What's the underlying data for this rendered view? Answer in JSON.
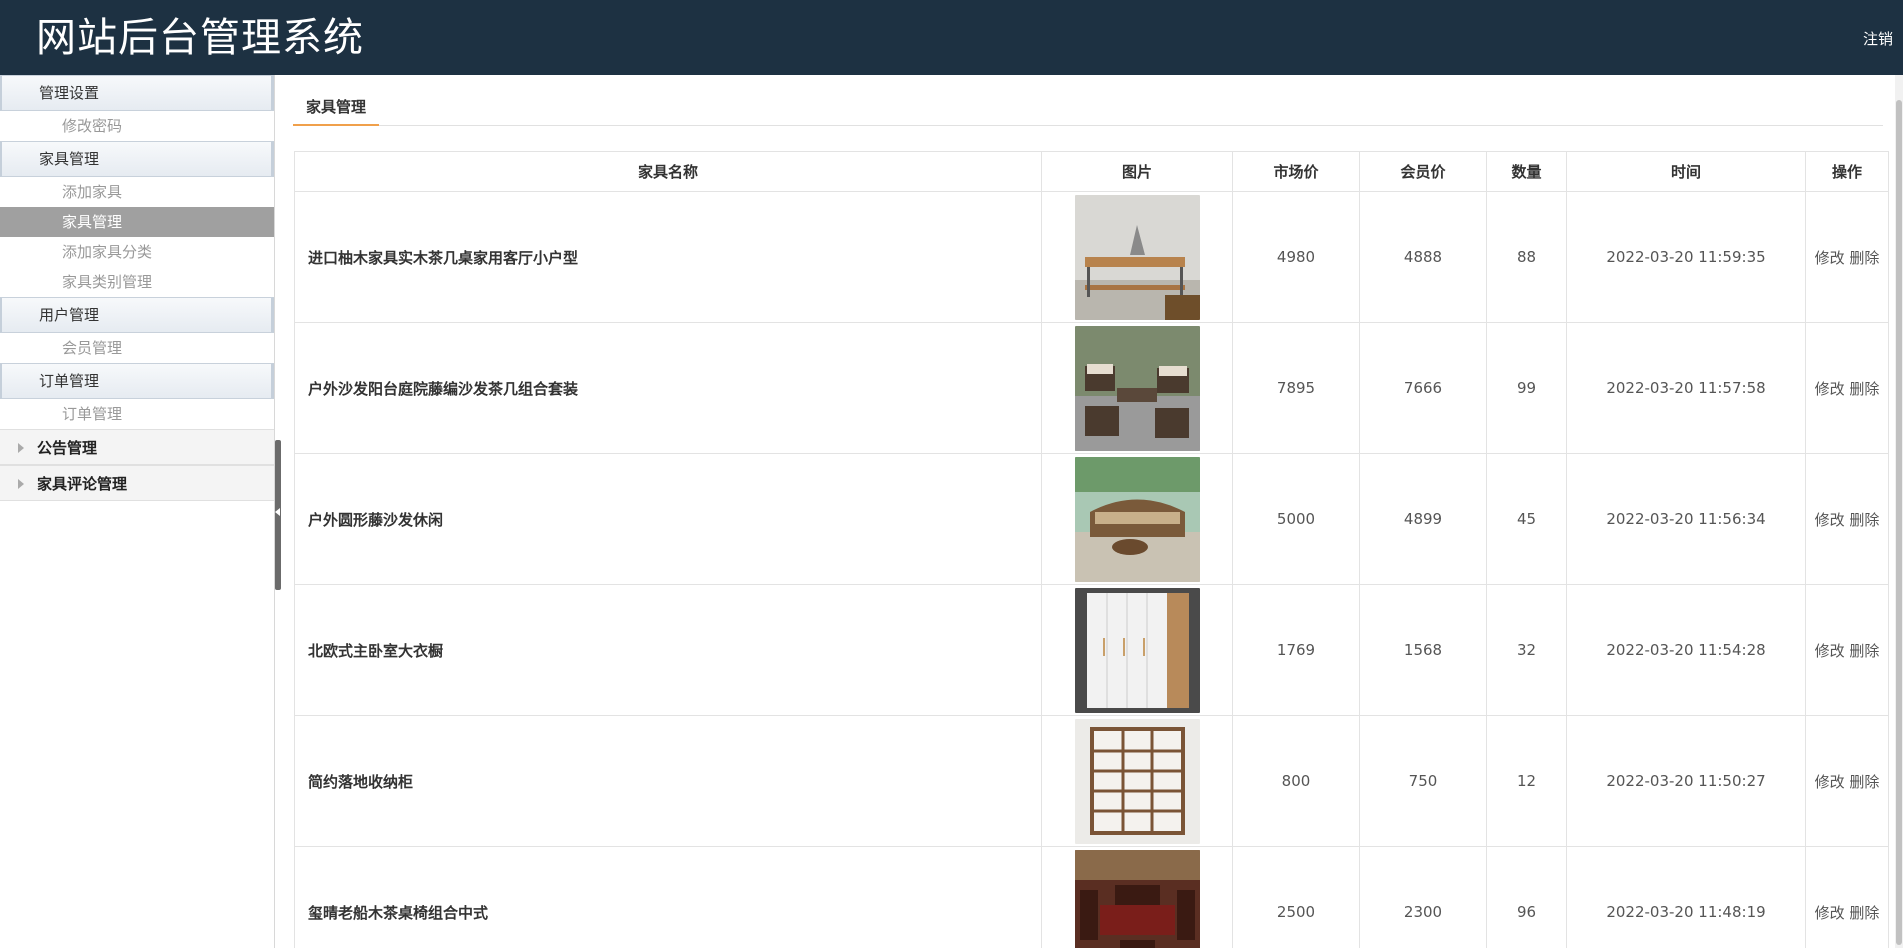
{
  "header": {
    "title": "网站后台管理系统",
    "logout": "注销"
  },
  "sidebar": {
    "groups": [
      {
        "title": "管理设置",
        "items": [
          {
            "label": "修改密码"
          }
        ]
      },
      {
        "title": "家具管理",
        "items": [
          {
            "label": "添加家具"
          },
          {
            "label": "家具管理"
          },
          {
            "label": "添加家具分类"
          },
          {
            "label": "家具类别管理"
          }
        ]
      },
      {
        "title": "用户管理",
        "items": [
          {
            "label": "会员管理"
          }
        ]
      },
      {
        "title": "订单管理",
        "items": [
          {
            "label": "订单管理"
          }
        ]
      }
    ],
    "collapsed": [
      {
        "title": "公告管理"
      },
      {
        "title": "家具评论管理"
      }
    ]
  },
  "main": {
    "tab": "家具管理",
    "columns": [
      "家具名称",
      "图片",
      "市场价",
      "会员价",
      "数量",
      "时间",
      "操作"
    ],
    "rows": [
      {
        "name": "进口柚木家具实木茶几桌家用客厅小户型",
        "image": "teak-coffee-table",
        "market": "4980",
        "member": "4888",
        "qty": "88",
        "time": "2022-03-20 11:59:35"
      },
      {
        "name": "户外沙发阳台庭院藤编沙发茶几组合套装",
        "image": "rattan-sofa-set",
        "market": "7895",
        "member": "7666",
        "qty": "99",
        "time": "2022-03-20 11:57:58"
      },
      {
        "name": "户外圆形藤沙发休闲",
        "image": "round-rattan-sofa",
        "market": "5000",
        "member": "4899",
        "qty": "45",
        "time": "2022-03-20 11:56:34"
      },
      {
        "name": "北欧式主卧室大衣橱",
        "image": "wardrobe",
        "market": "1769",
        "member": "1568",
        "qty": "32",
        "time": "2022-03-20 11:54:28"
      },
      {
        "name": "简约落地收纳柜",
        "image": "storage-shelf",
        "market": "800",
        "member": "750",
        "qty": "12",
        "time": "2022-03-20 11:50:27"
      },
      {
        "name": "玺晴老船木茶桌椅组合中式",
        "image": "tea-table-set",
        "market": "2500",
        "member": "2300",
        "qty": "96",
        "time": "2022-03-20 11:48:19"
      }
    ],
    "op_edit": "修改",
    "op_delete": "删除"
  },
  "colors": {
    "header_bg": "#1d3142",
    "tab_accent": "#f0a04b",
    "active_item_bg": "#a0a0a0"
  }
}
